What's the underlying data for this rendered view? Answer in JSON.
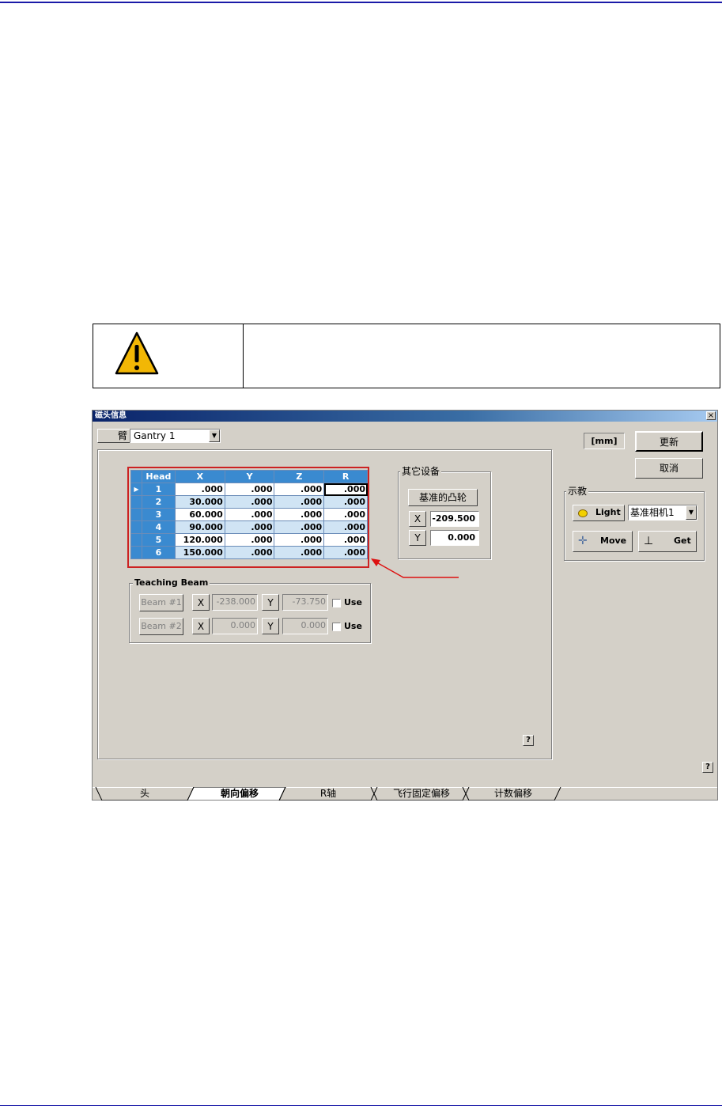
{
  "window": {
    "title": "磁头信息",
    "close": "×"
  },
  "top": {
    "arm_label": "臂",
    "gantry_value": "Gantry 1",
    "unit": "[mm]",
    "update_button": "更新",
    "cancel_button": "取消"
  },
  "grid": {
    "columns": [
      "Head",
      "X",
      "Y",
      "Z",
      "R"
    ],
    "rows": [
      [
        "1",
        ".000",
        ".000",
        ".000",
        ".000"
      ],
      [
        "2",
        "30.000",
        ".000",
        ".000",
        ".000"
      ],
      [
        "3",
        "60.000",
        ".000",
        ".000",
        ".000"
      ],
      [
        "4",
        "90.000",
        ".000",
        ".000",
        ".000"
      ],
      [
        "5",
        "120.000",
        ".000",
        ".000",
        ".000"
      ],
      [
        "6",
        "150.000",
        ".000",
        ".000",
        ".000"
      ]
    ]
  },
  "other_devices": {
    "title": "其它设备",
    "cam_button": "基准的凸轮",
    "x_label": "X",
    "x_value": "-209.500",
    "y_label": "Y",
    "y_value": "0.000"
  },
  "teaching_beam": {
    "title": "Teaching Beam",
    "beam1": {
      "label": "Beam #1",
      "x_label": "X",
      "x_value": "-238.000",
      "y_label": "Y",
      "y_value": "-73.750",
      "use_label": "Use"
    },
    "beam2": {
      "label": "Beam #2",
      "x_label": "X",
      "x_value": "0.000",
      "y_label": "Y",
      "y_value": "0.000",
      "use_label": "Use"
    }
  },
  "teach": {
    "title": "示教",
    "light_button": "Light",
    "camera_select": "基准相机1",
    "move_button": "Move",
    "get_button": "Get"
  },
  "help_label": "?",
  "tabs": [
    "头",
    "朝向偏移",
    "R轴",
    "飞行固定偏移",
    "计数偏移"
  ],
  "colors": {
    "accent": "#3a8ad0",
    "highlight": "#cc2222",
    "rule": "#1a1aa8",
    "warning": "#f2b705"
  }
}
